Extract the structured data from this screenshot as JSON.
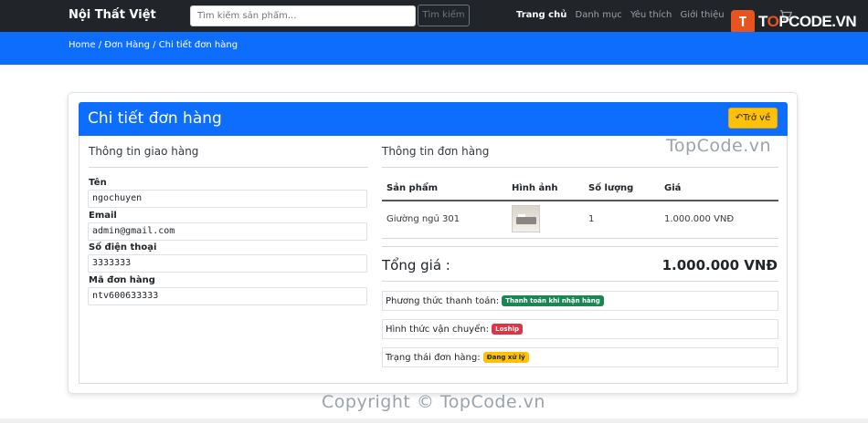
{
  "navbar": {
    "brand": "Nội Thất Việt",
    "search_placeholder": "Tìm kiếm sản phẩm...",
    "search_button": "Tìm kiếm",
    "links": [
      "Trang chủ",
      "Danh mục",
      "Yêu thích",
      "Giới thiệu",
      "ngo"
    ]
  },
  "logo": {
    "badge": "T",
    "text_a": "T",
    "text_o": "O",
    "text_b": "PCODE.VN"
  },
  "breadcrumb": "Home / Đơn Hàng / Chi tiết đơn hàng",
  "card": {
    "title": "Chi tiết đơn hàng",
    "back_button": "Trở về"
  },
  "shipping": {
    "title": "Thông tin giao hàng",
    "name_label": "Tên",
    "name_value": "ngochuyen",
    "email_label": "Email",
    "email_value": "admin@gmail.com",
    "phone_label": "Số điện thoại",
    "phone_value": "3333333",
    "order_code_label": "Mã đơn hàng",
    "order_code_value": "ntv600633333"
  },
  "order": {
    "title": "Thông tin đơn hàng",
    "columns": [
      "Sản phẩm",
      "Hình ảnh",
      "Số lượng",
      "Giá"
    ],
    "rows": [
      {
        "product": "Giường ngủ 301",
        "quantity": "1",
        "price": "1.000.000 VNĐ"
      }
    ],
    "total_label": "Tổng giá :",
    "total_value": "1.000.000 VNĐ",
    "payment_label": "Phương thức thanh toán:",
    "payment_badge": "Thanh toán khi nhận hàng",
    "shipping_label": "Hình thức vận chuyển:",
    "shipping_badge": "Loship",
    "status_label": "Trạng thái đơn hàng:",
    "status_badge": "Đang xử lý"
  },
  "watermarks": {
    "right": "TopCode.vn",
    "bottom": "Copyright © TopCode.vn"
  },
  "colors": {
    "primary": "#0d6efd",
    "warning": "#ffc107",
    "success": "#198754",
    "danger": "#dc3545",
    "navbar": "#212529",
    "logo_accent": "#e8541f"
  }
}
